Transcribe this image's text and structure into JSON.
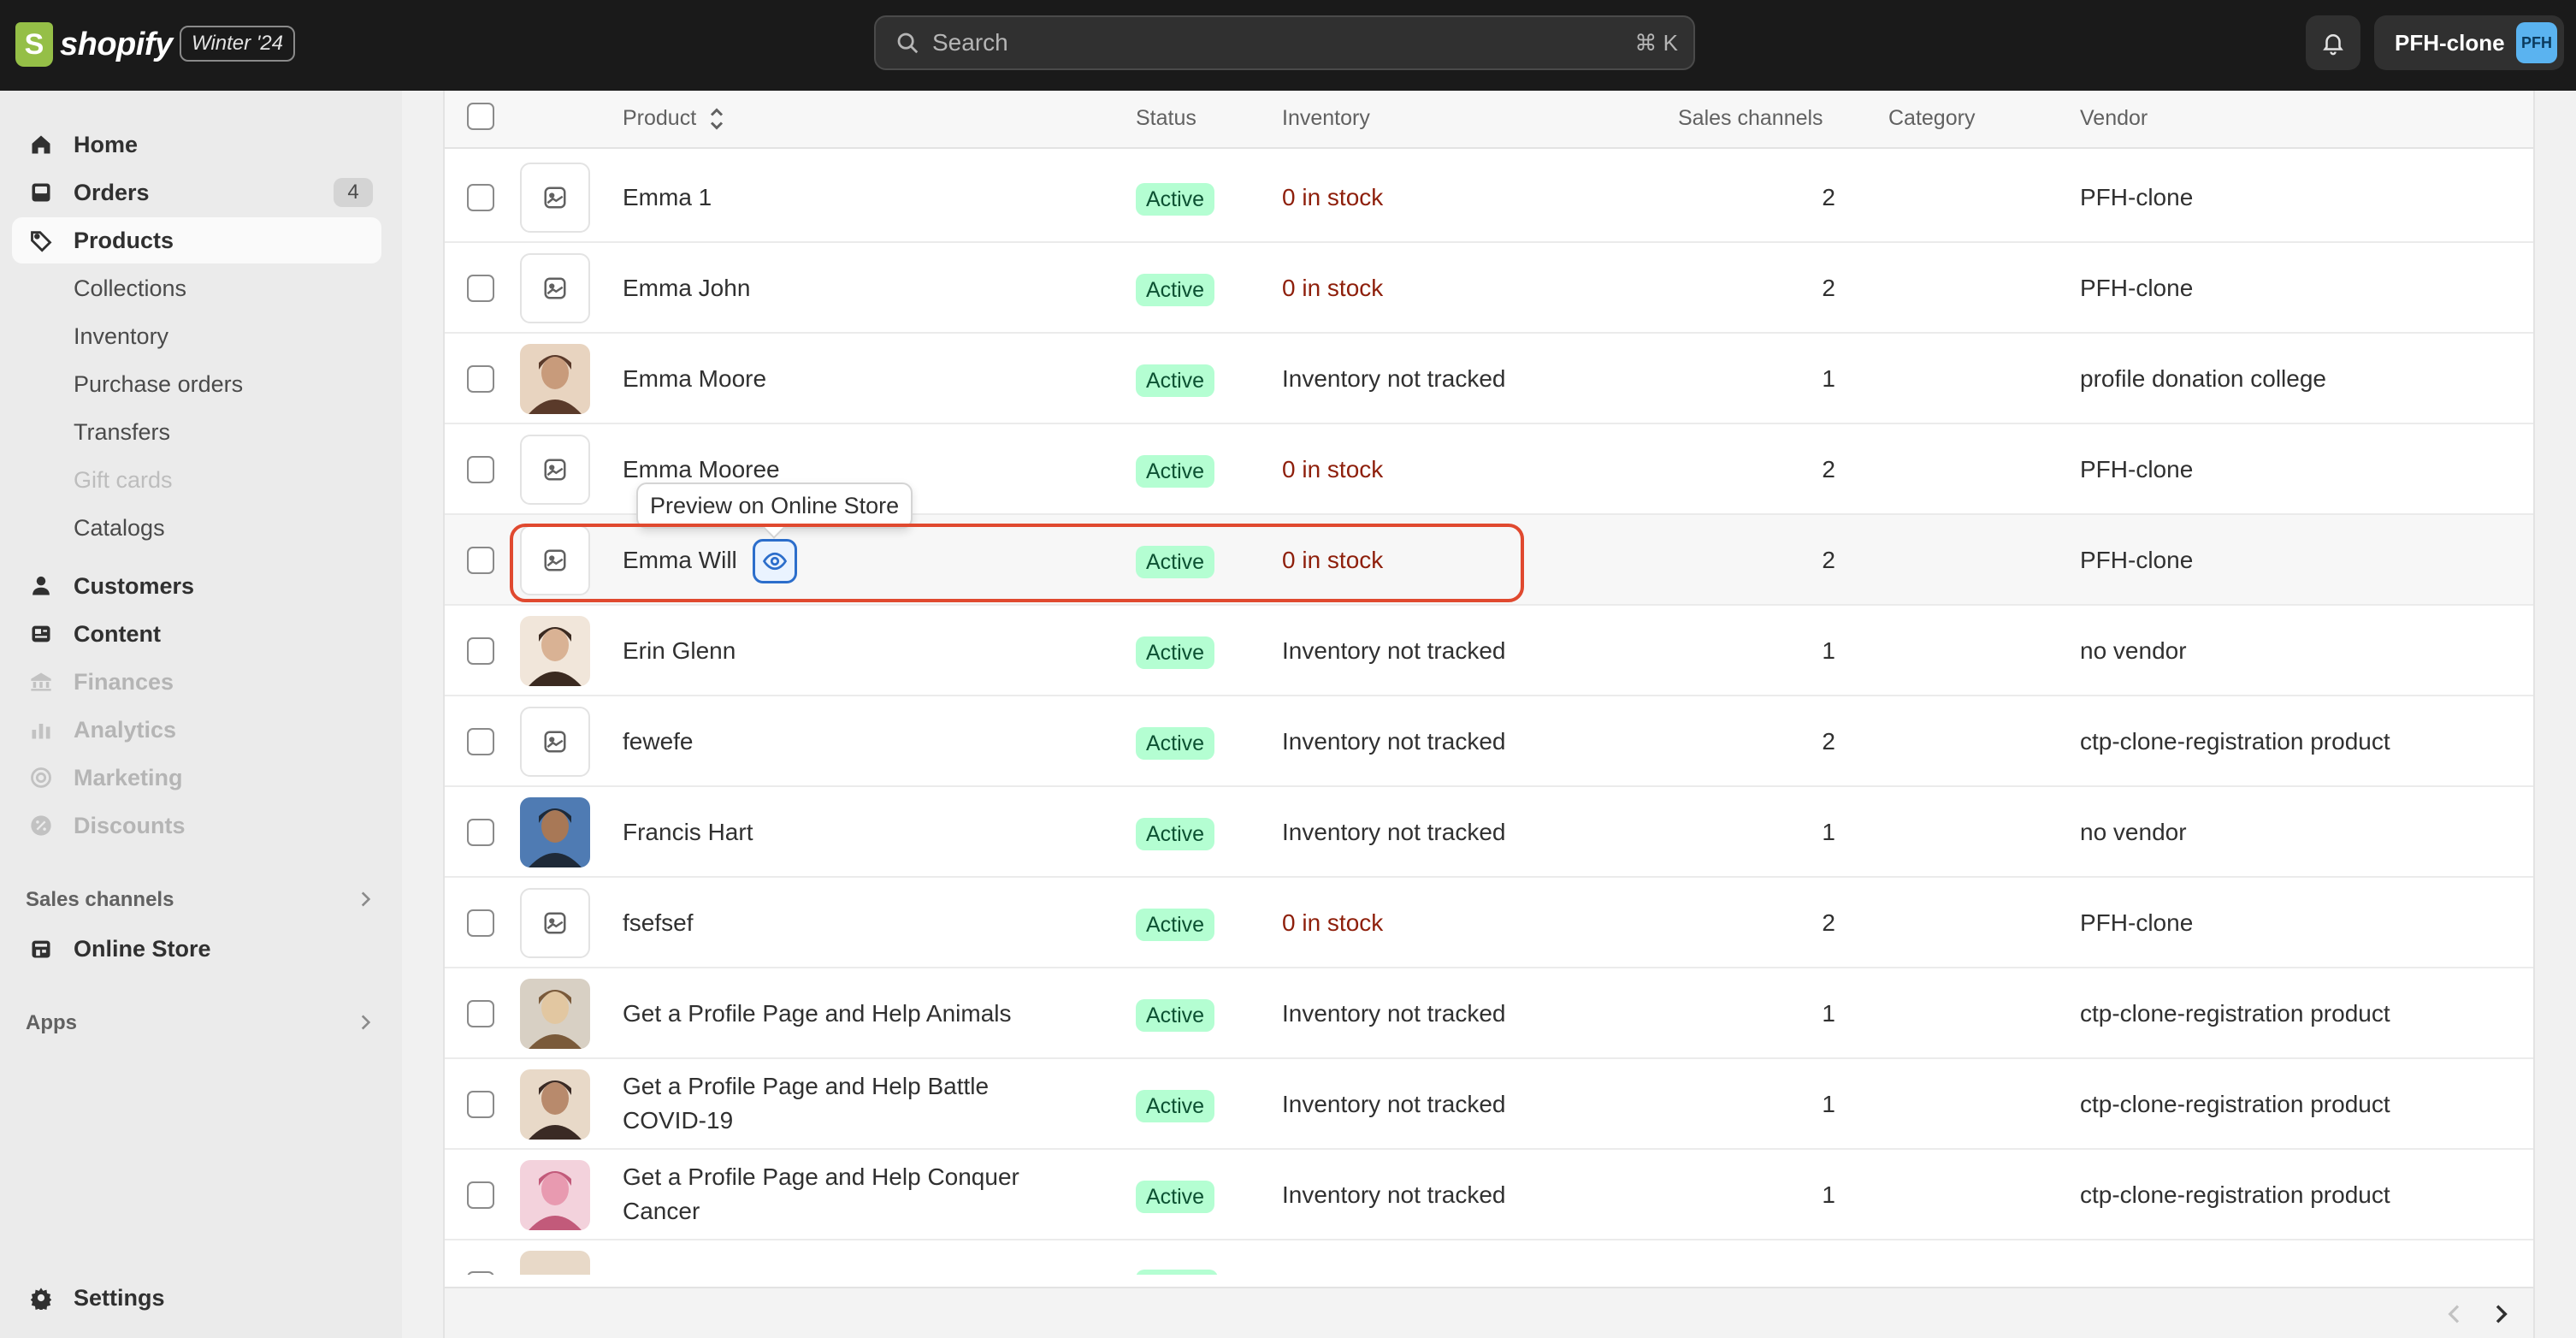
{
  "topbar": {
    "logo_letter": "S",
    "logo_text": "shopify",
    "edition": "Winter '24",
    "search_placeholder": "Search",
    "search_shortcut": "⌘ K",
    "store_name": "PFH-clone",
    "store_initials": "PFH"
  },
  "sidebar": {
    "items": [
      {
        "label": "Home",
        "icon": "home-icon"
      },
      {
        "label": "Orders",
        "icon": "orders-icon",
        "badge": "4"
      },
      {
        "label": "Products",
        "icon": "tag-icon",
        "active": true
      },
      {
        "label": "Collections",
        "sub": true
      },
      {
        "label": "Inventory",
        "sub": true
      },
      {
        "label": "Purchase orders",
        "sub": true
      },
      {
        "label": "Transfers",
        "sub": true
      },
      {
        "label": "Gift cards",
        "sub": true,
        "disabled": true
      },
      {
        "label": "Catalogs",
        "sub": true
      },
      {
        "label": "Customers",
        "icon": "person-icon"
      },
      {
        "label": "Content",
        "icon": "content-icon"
      },
      {
        "label": "Finances",
        "icon": "bank-icon",
        "disabled": true
      },
      {
        "label": "Analytics",
        "icon": "chart-icon",
        "disabled": true
      },
      {
        "label": "Marketing",
        "icon": "target-icon",
        "disabled": true
      },
      {
        "label": "Discounts",
        "icon": "discount-icon",
        "disabled": true
      }
    ],
    "sales_channels_heading": "Sales channels",
    "online_store": "Online Store",
    "apps_heading": "Apps",
    "settings": "Settings"
  },
  "table": {
    "columns": {
      "product": "Product",
      "status": "Status",
      "inventory": "Inventory",
      "sales_channels": "Sales channels",
      "category": "Category",
      "vendor": "Vendor"
    },
    "rows": [
      {
        "name": "Emma 1",
        "name2": "",
        "status": "Active",
        "inventory": "0 in stock",
        "out": true,
        "channels": "2",
        "vendor": "PFH-clone",
        "thumb": "placeholder"
      },
      {
        "name": "Emma John",
        "name2": "",
        "status": "Active",
        "inventory": "0 in stock",
        "out": true,
        "channels": "2",
        "vendor": "PFH-clone",
        "thumb": "placeholder"
      },
      {
        "name": "Emma Moore",
        "name2": "",
        "status": "Active",
        "inventory": "Inventory not tracked",
        "out": false,
        "channels": "1",
        "vendor": "profile donation college",
        "thumb": "photo"
      },
      {
        "name": "Emma Mooree",
        "name2": "",
        "status": "Active",
        "inventory": "0 in stock",
        "out": true,
        "channels": "2",
        "vendor": "PFH-clone",
        "thumb": "placeholder"
      },
      {
        "name": "Emma Will",
        "name2": "",
        "status": "Active",
        "inventory": "0 in stock",
        "out": true,
        "channels": "2",
        "vendor": "PFH-clone",
        "thumb": "placeholder",
        "hover": true
      },
      {
        "name": "Erin Glenn",
        "name2": "",
        "status": "Active",
        "inventory": "Inventory not tracked",
        "out": false,
        "channels": "1",
        "vendor": "no vendor",
        "thumb": "photo"
      },
      {
        "name": "fewefe",
        "name2": "",
        "status": "Active",
        "inventory": "Inventory not tracked",
        "out": false,
        "channels": "2",
        "vendor": "ctp-clone-registration product",
        "thumb": "placeholder"
      },
      {
        "name": "Francis Hart",
        "name2": "",
        "status": "Active",
        "inventory": "Inventory not tracked",
        "out": false,
        "channels": "1",
        "vendor": "no vendor",
        "thumb": "photo"
      },
      {
        "name": "fsefsef",
        "name2": "",
        "status": "Active",
        "inventory": "0 in stock",
        "out": true,
        "channels": "2",
        "vendor": "PFH-clone",
        "thumb": "placeholder"
      },
      {
        "name": "Get a Profile Page and Help Animals",
        "name2": "",
        "status": "Active",
        "inventory": "Inventory not tracked",
        "out": false,
        "channels": "1",
        "vendor": "ctp-clone-registration product",
        "thumb": "photo"
      },
      {
        "name": "Get a Profile Page and Help Battle",
        "name2": "COVID-19",
        "status": "Active",
        "inventory": "Inventory not tracked",
        "out": false,
        "channels": "1",
        "vendor": "ctp-clone-registration product",
        "thumb": "photo"
      },
      {
        "name": "Get a Profile Page and Help Conquer",
        "name2": "Cancer",
        "status": "Active",
        "inventory": "Inventory not tracked",
        "out": false,
        "channels": "1",
        "vendor": "ctp-clone-registration product",
        "thumb": "photo"
      }
    ],
    "tooltip": "Preview on Online Store"
  },
  "colors": {
    "topbar": "#1a1a1a",
    "active_badge_bg": "#b4fed2",
    "active_badge_text": "#0c5132",
    "out_of_stock": "#8e1f0b",
    "highlight": "#e0492f",
    "eye_button": "#2c6ecb"
  }
}
